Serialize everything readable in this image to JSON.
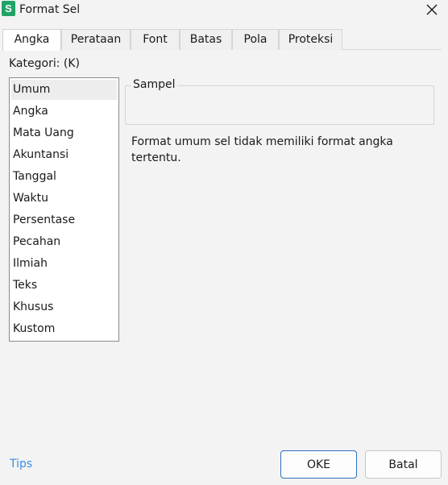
{
  "window": {
    "title": "Format Sel",
    "app_icon_letter": "S"
  },
  "tabs": [
    {
      "label": "Angka"
    },
    {
      "label": "Perataan"
    },
    {
      "label": "Font"
    },
    {
      "label": "Batas"
    },
    {
      "label": "Pola"
    },
    {
      "label": "Proteksi"
    }
  ],
  "kategori": {
    "label": "Kategori: (K)",
    "items": [
      "Umum",
      "Angka",
      "Mata Uang",
      "Akuntansi",
      "Tanggal",
      "Waktu",
      "Persentase",
      "Pecahan",
      "Ilmiah",
      "Teks",
      "Khusus",
      "Kustom"
    ],
    "selected": "Umum"
  },
  "sample": {
    "legend": "Sampel"
  },
  "description": "Format umum sel tidak memiliki format angka tertentu.",
  "footer": {
    "tips": "Tips",
    "ok": "OKE",
    "cancel": "Batal"
  },
  "colors": {
    "accent": "#2f6fc4",
    "link": "#3a8ee6",
    "app_icon": "#21a366"
  }
}
